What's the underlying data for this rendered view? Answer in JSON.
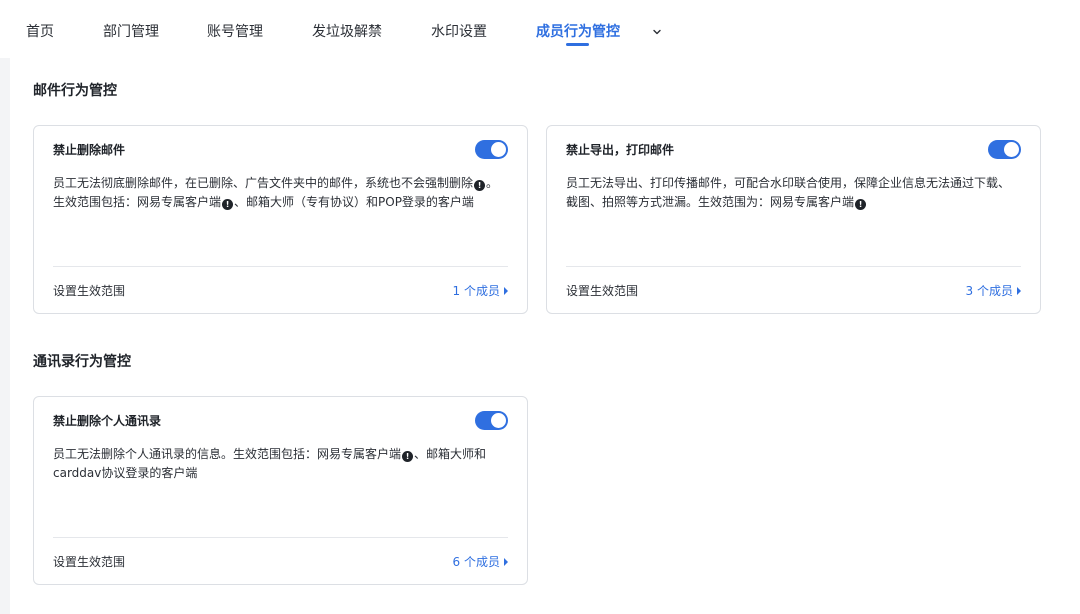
{
  "nav": {
    "tabs": [
      {
        "label": "首页"
      },
      {
        "label": "部门管理"
      },
      {
        "label": "账号管理"
      },
      {
        "label": "发垃圾解禁"
      },
      {
        "label": "水印设置"
      },
      {
        "label": "成员行为管控",
        "active": true
      }
    ],
    "more_icon": "chevron-down-icon"
  },
  "colors": {
    "accent": "#2f6fe0",
    "page_bg": "#f3f4f6",
    "card_border": "#dcdfe4"
  },
  "sections": [
    {
      "title": "邮件行为管控",
      "cards": [
        {
          "title": "禁止删除邮件",
          "enabled": true,
          "desc_parts": [
            "员工无法彻底删除邮件，在已删除、广告文件夹中的邮件，系统也不会强制删除",
            "。生效范围包括：网易专属客户端",
            "、邮箱大师（专有协议）和POP登录的客户端"
          ],
          "footer_label": "设置生效范围",
          "footer_link": "1 个成员"
        },
        {
          "title": "禁止导出，打印邮件",
          "enabled": true,
          "desc_parts": [
            "员工无法导出、打印传播邮件，可配合水印联合使用，保障企业信息无法通过下载、截图、拍照等方式泄漏。生效范围为：网易专属客户端",
            ""
          ],
          "footer_label": "设置生效范围",
          "footer_link": "3 个成员"
        }
      ]
    },
    {
      "title": "通讯录行为管控",
      "cards": [
        {
          "title": "禁止删除个人通讯录",
          "enabled": true,
          "desc_parts": [
            "员工无法删除个人通讯录的信息。生效范围包括：网易专属客户端",
            "、邮箱大师和carddav协议登录的客户端"
          ],
          "footer_label": "设置生效范围",
          "footer_link": "6 个成员"
        }
      ]
    }
  ]
}
